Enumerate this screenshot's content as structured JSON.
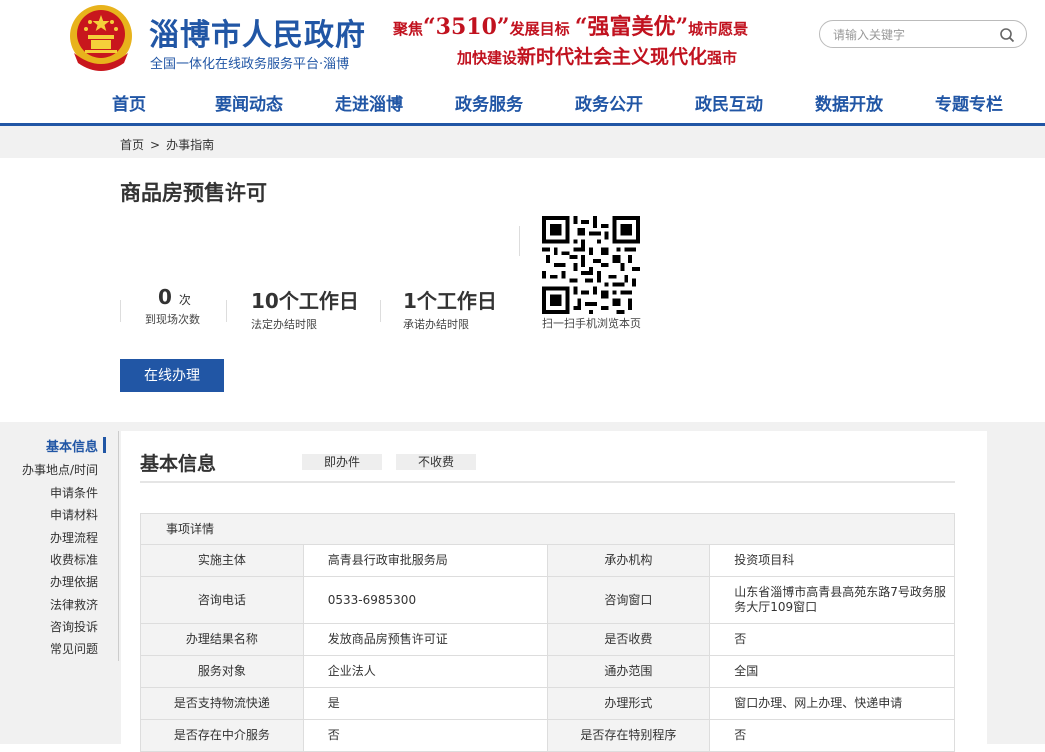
{
  "header": {
    "title": "淄博市人民政府",
    "subtitle": "全国一体化在线政务服务平台·淄博",
    "slogan_line1_a": "聚焦",
    "slogan_line1_b": "“3510”",
    "slogan_line1_c": "发展目标",
    "slogan_line1_d": "“强富美优”",
    "slogan_line1_e": "城市愿景",
    "slogan_line2_a": "加快建设",
    "slogan_line2_b": "新时代社会主义现代化",
    "slogan_line2_c": "强市",
    "search_placeholder": "请输入关键字"
  },
  "nav": [
    "首页",
    "要闻动态",
    "走进淄博",
    "政务服务",
    "政务公开",
    "政民互动",
    "数据开放",
    "专题专栏"
  ],
  "breadcrumb": {
    "home": "首页",
    "sep": ">",
    "current": "办事指南"
  },
  "item": {
    "title": "商品房预售许可",
    "visits_value": "0",
    "visits_unit": "次",
    "visits_label": "到现场次数",
    "legal_limit_value": "10个工作日",
    "legal_limit_label": "法定办结时限",
    "promise_limit_value": "1个工作日",
    "promise_limit_label": "承诺办结时限",
    "qr_label": "扫一扫手机浏览本页",
    "online_button": "在线办理"
  },
  "side_menu": [
    "基本信息",
    "办事地点/时间",
    "申请条件",
    "申请材料",
    "办理流程",
    "收费标准",
    "办理依据",
    "法律救济",
    "咨询投诉",
    "常见问题"
  ],
  "panel": {
    "title": "基本信息",
    "tags": [
      "即办件",
      "不收费"
    ],
    "detail_header": "事项详情",
    "rows": [
      [
        "实施主体",
        "高青县行政审批服务局",
        "承办机构",
        "投资项目科"
      ],
      [
        "咨询电话",
        "0533-6985300",
        "咨询窗口",
        "山东省淄博市高青县高苑东路7号政务服务大厅109窗口"
      ],
      [
        "办理结果名称",
        "发放商品房预售许可证",
        "是否收费",
        "否"
      ],
      [
        "服务对象",
        "企业法人",
        "通办范围",
        "全国"
      ],
      [
        "是否支持物流快递",
        "是",
        "办理形式",
        "窗口办理、网上办理、快递申请"
      ],
      [
        "是否存在中介服务",
        "否",
        "是否存在特别程序",
        "否"
      ]
    ]
  },
  "colors": {
    "brand_blue": "#2156a5",
    "slogan_red": "#c1121f",
    "bg_gray": "#f1f1f1"
  }
}
